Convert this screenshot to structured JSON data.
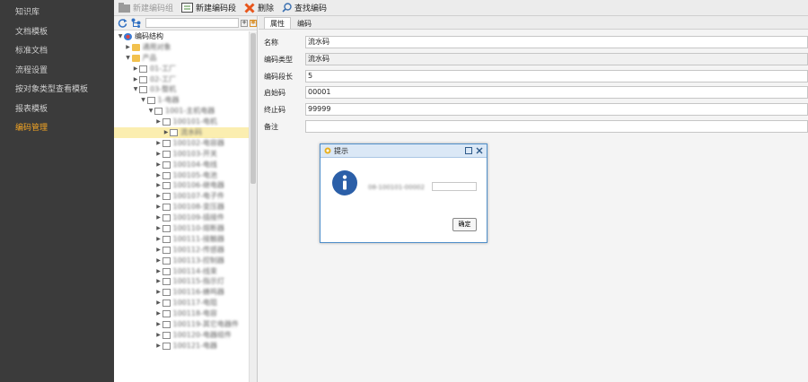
{
  "nav": {
    "items": [
      {
        "label": "知识库",
        "active": false
      },
      {
        "label": "文档模板",
        "active": false
      },
      {
        "label": "标准文档",
        "active": false
      },
      {
        "label": "流程设置",
        "active": false
      },
      {
        "label": "按对象类型查看模板",
        "active": false
      },
      {
        "label": "报表模板",
        "active": false
      },
      {
        "label": "编码管理",
        "active": true
      }
    ]
  },
  "toolbar": {
    "new_group": "新建编码组",
    "new_segment": "新建编码段",
    "delete": "删除",
    "find": "查找编码"
  },
  "tree": {
    "root": "编码结构",
    "nodes": [
      {
        "label": "编码结构",
        "depth": 0,
        "type": "root",
        "expanded": true,
        "selected": false
      },
      {
        "label": "通用对象",
        "depth": 1,
        "type": "folder",
        "expanded": false,
        "selected": false
      },
      {
        "label": "产品",
        "depth": 1,
        "type": "folder",
        "expanded": true,
        "selected": false
      },
      {
        "label": "01-工厂",
        "depth": 2,
        "type": "doc",
        "expanded": false,
        "selected": false
      },
      {
        "label": "02-工厂",
        "depth": 2,
        "type": "doc",
        "expanded": false,
        "selected": false
      },
      {
        "label": "03-整机",
        "depth": 2,
        "type": "doc",
        "expanded": true,
        "selected": false
      },
      {
        "label": "1-电器",
        "depth": 3,
        "type": "doc",
        "expanded": true,
        "selected": false
      },
      {
        "label": "1001-主机电器",
        "depth": 4,
        "type": "doc",
        "expanded": true,
        "selected": false
      },
      {
        "label": "100101-电机",
        "depth": 5,
        "type": "doc",
        "expanded": false,
        "selected": false
      },
      {
        "label": "流水码",
        "depth": 6,
        "type": "doc",
        "expanded": false,
        "selected": true
      },
      {
        "label": "100102-电容器",
        "depth": 5,
        "type": "doc",
        "expanded": false,
        "selected": false
      },
      {
        "label": "100103-开关",
        "depth": 5,
        "type": "doc",
        "expanded": false,
        "selected": false
      },
      {
        "label": "100104-电线",
        "depth": 5,
        "type": "doc",
        "expanded": false,
        "selected": false
      },
      {
        "label": "100105-电池",
        "depth": 5,
        "type": "doc",
        "expanded": false,
        "selected": false
      },
      {
        "label": "100106-继电器",
        "depth": 5,
        "type": "doc",
        "expanded": false,
        "selected": false
      },
      {
        "label": "100107-电子件",
        "depth": 5,
        "type": "doc",
        "expanded": false,
        "selected": false
      },
      {
        "label": "100108-变压器",
        "depth": 5,
        "type": "doc",
        "expanded": false,
        "selected": false
      },
      {
        "label": "100109-插接件",
        "depth": 5,
        "type": "doc",
        "expanded": false,
        "selected": false
      },
      {
        "label": "100110-熔断器",
        "depth": 5,
        "type": "doc",
        "expanded": false,
        "selected": false
      },
      {
        "label": "100111-接触器",
        "depth": 5,
        "type": "doc",
        "expanded": false,
        "selected": false
      },
      {
        "label": "100112-传感器",
        "depth": 5,
        "type": "doc",
        "expanded": false,
        "selected": false
      },
      {
        "label": "100113-控制器",
        "depth": 5,
        "type": "doc",
        "expanded": false,
        "selected": false
      },
      {
        "label": "100114-线束",
        "depth": 5,
        "type": "doc",
        "expanded": false,
        "selected": false
      },
      {
        "label": "100115-指示灯",
        "depth": 5,
        "type": "doc",
        "expanded": false,
        "selected": false
      },
      {
        "label": "100116-蜂鸣器",
        "depth": 5,
        "type": "doc",
        "expanded": false,
        "selected": false
      },
      {
        "label": "100117-电阻",
        "depth": 5,
        "type": "doc",
        "expanded": false,
        "selected": false
      },
      {
        "label": "100118-电容",
        "depth": 5,
        "type": "doc",
        "expanded": false,
        "selected": false
      },
      {
        "label": "100119-其它电器件",
        "depth": 5,
        "type": "doc",
        "expanded": false,
        "selected": false
      },
      {
        "label": "100120-电器组件",
        "depth": 5,
        "type": "doc",
        "expanded": false,
        "selected": false
      },
      {
        "label": "100121-电器",
        "depth": 5,
        "type": "doc",
        "expanded": false,
        "selected": false
      }
    ]
  },
  "tabs": [
    {
      "label": "属性",
      "active": true
    },
    {
      "label": "编码",
      "active": false
    }
  ],
  "form": {
    "name_label": "名称",
    "name_value": "流水码",
    "type_label": "编码类型",
    "type_value": "流水码",
    "length_label": "编码段长",
    "length_value": "5",
    "start_label": "启始码",
    "start_value": "00001",
    "end_label": "终止码",
    "end_value": "99999",
    "remark_label": "备注",
    "remark_value": ""
  },
  "dialog": {
    "title": "提示",
    "message": "08-100101-00002",
    "ok_label": "确定"
  },
  "colors": {
    "nav_bg": "#3b3b3b",
    "nav_active": "#f5a623",
    "selection": "#fbeeb0",
    "dialog_border": "#4f8ec9"
  }
}
